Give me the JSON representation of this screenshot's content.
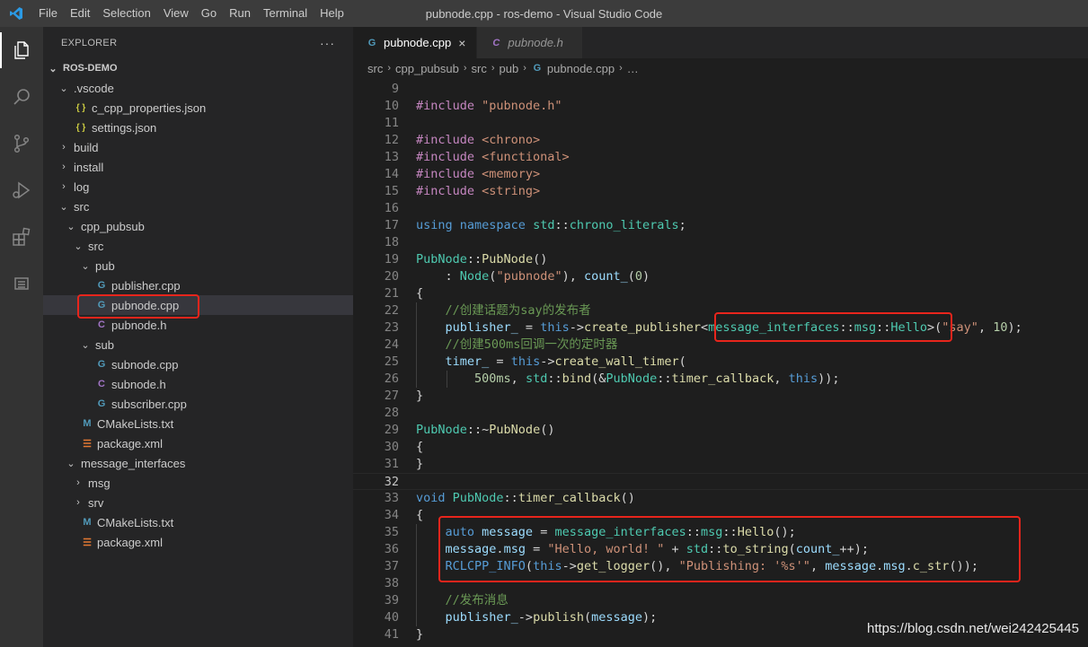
{
  "menu": [
    "File",
    "Edit",
    "Selection",
    "View",
    "Go",
    "Run",
    "Terminal",
    "Help"
  ],
  "window_title": "pubnode.cpp - ros-demo - Visual Studio Code",
  "activity_icons": [
    "files-icon",
    "search-icon",
    "source-control-icon",
    "run-debug-icon",
    "extensions-icon",
    "panel-icon"
  ],
  "sidebar": {
    "header": "EXPLORER",
    "more": "···",
    "root": "ROS-DEMO",
    "items": [
      {
        "label": ".vscode",
        "type": "folder-open",
        "depth": 1
      },
      {
        "label": "c_cpp_properties.json",
        "type": "json",
        "depth": 2
      },
      {
        "label": "settings.json",
        "type": "json",
        "depth": 2
      },
      {
        "label": "build",
        "type": "folder",
        "depth": 1
      },
      {
        "label": "install",
        "type": "folder",
        "depth": 1
      },
      {
        "label": "log",
        "type": "folder",
        "depth": 1
      },
      {
        "label": "src",
        "type": "folder-open",
        "depth": 1
      },
      {
        "label": "cpp_pubsub",
        "type": "folder-open",
        "depth": 2
      },
      {
        "label": "src",
        "type": "folder-open",
        "depth": 3
      },
      {
        "label": "pub",
        "type": "folder-open",
        "depth": 4
      },
      {
        "label": "publisher.cpp",
        "type": "cpp",
        "depth": 5
      },
      {
        "label": "pubnode.cpp",
        "type": "cpp",
        "depth": 5,
        "selected": true
      },
      {
        "label": "pubnode.h",
        "type": "h",
        "depth": 5
      },
      {
        "label": "sub",
        "type": "folder-open",
        "depth": 4
      },
      {
        "label": "subnode.cpp",
        "type": "cpp",
        "depth": 5
      },
      {
        "label": "subnode.h",
        "type": "h",
        "depth": 5
      },
      {
        "label": "subscriber.cpp",
        "type": "cpp",
        "depth": 5
      },
      {
        "label": "CMakeLists.txt",
        "type": "cmake",
        "depth": 3
      },
      {
        "label": "package.xml",
        "type": "xml",
        "depth": 3
      },
      {
        "label": "message_interfaces",
        "type": "folder-open",
        "depth": 2
      },
      {
        "label": "msg",
        "type": "folder",
        "depth": 3
      },
      {
        "label": "srv",
        "type": "folder",
        "depth": 3
      },
      {
        "label": "CMakeLists.txt",
        "type": "cmake",
        "depth": 3
      },
      {
        "label": "package.xml",
        "type": "xml",
        "depth": 3
      }
    ]
  },
  "tabs": [
    {
      "label": "pubnode.cpp",
      "active": true,
      "close": "×"
    },
    {
      "label": "pubnode.h",
      "active": false
    }
  ],
  "breadcrumb": [
    "src",
    "cpp_pubsub",
    "src",
    "pub",
    "pubnode.cpp",
    "…"
  ],
  "code_lines": [
    {
      "n": "9",
      "g": 0,
      "t": []
    },
    {
      "n": "10",
      "g": 0,
      "t": [
        [
          "pp",
          "#include "
        ],
        [
          "str",
          "\"pubnode.h\""
        ]
      ]
    },
    {
      "n": "11",
      "g": 0,
      "t": []
    },
    {
      "n": "12",
      "g": 0,
      "t": [
        [
          "pp",
          "#include "
        ],
        [
          "str",
          "<chrono>"
        ]
      ]
    },
    {
      "n": "13",
      "g": 0,
      "t": [
        [
          "pp",
          "#include "
        ],
        [
          "str",
          "<functional>"
        ]
      ]
    },
    {
      "n": "14",
      "g": 0,
      "t": [
        [
          "pp",
          "#include "
        ],
        [
          "str",
          "<memory>"
        ]
      ]
    },
    {
      "n": "15",
      "g": 0,
      "t": [
        [
          "pp",
          "#include "
        ],
        [
          "str",
          "<string>"
        ]
      ]
    },
    {
      "n": "16",
      "g": 0,
      "t": []
    },
    {
      "n": "17",
      "g": 0,
      "t": [
        [
          "kw",
          "using "
        ],
        [
          "kw",
          "namespace "
        ],
        [
          "cls",
          "std"
        ],
        [
          "pl",
          "::"
        ],
        [
          "cls",
          "chrono_literals"
        ],
        [
          "pl",
          ";"
        ]
      ]
    },
    {
      "n": "18",
      "g": 0,
      "t": []
    },
    {
      "n": "19",
      "g": 0,
      "t": [
        [
          "cls",
          "PubNode"
        ],
        [
          "pl",
          "::"
        ],
        [
          "fn",
          "PubNode"
        ],
        [
          "pl",
          "()"
        ]
      ]
    },
    {
      "n": "20",
      "g": 0,
      "t": [
        [
          "pl",
          "    : "
        ],
        [
          "cls",
          "Node"
        ],
        [
          "pl",
          "("
        ],
        [
          "str",
          "\"pubnode\""
        ],
        [
          "pl",
          "), "
        ],
        [
          "var",
          "count_"
        ],
        [
          "pl",
          "("
        ],
        [
          "num",
          "0"
        ],
        [
          "pl",
          ")"
        ]
      ]
    },
    {
      "n": "21",
      "g": 0,
      "t": [
        [
          "pl",
          "{"
        ]
      ]
    },
    {
      "n": "22",
      "g": 1,
      "t": [
        [
          "pl",
          "    "
        ],
        [
          "cm",
          "//创建话题为say的发布者"
        ]
      ]
    },
    {
      "n": "23",
      "g": 1,
      "t": [
        [
          "pl",
          "    "
        ],
        [
          "var",
          "publisher_"
        ],
        [
          "pl",
          " = "
        ],
        [
          "kw",
          "this"
        ],
        [
          "pl",
          "->"
        ],
        [
          "fn",
          "create_publisher"
        ],
        [
          "pl",
          "<"
        ],
        [
          "cls",
          "message_interfaces"
        ],
        [
          "pl",
          "::"
        ],
        [
          "cls",
          "msg"
        ],
        [
          "pl",
          "::"
        ],
        [
          "cls",
          "Hello"
        ],
        [
          "pl",
          ">("
        ],
        [
          "str",
          "\"say\""
        ],
        [
          "pl",
          ", "
        ],
        [
          "num",
          "10"
        ],
        [
          "pl",
          ");"
        ]
      ]
    },
    {
      "n": "24",
      "g": 1,
      "t": [
        [
          "pl",
          "    "
        ],
        [
          "cm",
          "//创建500ms回调一次的定时器"
        ]
      ]
    },
    {
      "n": "25",
      "g": 1,
      "t": [
        [
          "pl",
          "    "
        ],
        [
          "var",
          "timer_"
        ],
        [
          "pl",
          " = "
        ],
        [
          "kw",
          "this"
        ],
        [
          "pl",
          "->"
        ],
        [
          "fn",
          "create_wall_timer"
        ],
        [
          "pl",
          "("
        ]
      ]
    },
    {
      "n": "26",
      "g": 2,
      "t": [
        [
          "pl",
          "        "
        ],
        [
          "num",
          "500ms"
        ],
        [
          "pl",
          ", "
        ],
        [
          "cls",
          "std"
        ],
        [
          "pl",
          "::"
        ],
        [
          "fn",
          "bind"
        ],
        [
          "pl",
          "(&"
        ],
        [
          "cls",
          "PubNode"
        ],
        [
          "pl",
          "::"
        ],
        [
          "fn",
          "timer_callback"
        ],
        [
          "pl",
          ", "
        ],
        [
          "kw",
          "this"
        ],
        [
          "pl",
          "));"
        ]
      ]
    },
    {
      "n": "27",
      "g": 0,
      "t": [
        [
          "pl",
          "}"
        ]
      ]
    },
    {
      "n": "28",
      "g": 0,
      "t": []
    },
    {
      "n": "29",
      "g": 0,
      "t": [
        [
          "cls",
          "PubNode"
        ],
        [
          "pl",
          "::~"
        ],
        [
          "fn",
          "PubNode"
        ],
        [
          "pl",
          "()"
        ]
      ]
    },
    {
      "n": "30",
      "g": 0,
      "t": [
        [
          "pl",
          "{"
        ]
      ]
    },
    {
      "n": "31",
      "g": 0,
      "t": [
        [
          "pl",
          "}"
        ]
      ]
    },
    {
      "n": "32",
      "g": 0,
      "t": [],
      "current": true
    },
    {
      "n": "33",
      "g": 0,
      "t": [
        [
          "kw",
          "void "
        ],
        [
          "cls",
          "PubNode"
        ],
        [
          "pl",
          "::"
        ],
        [
          "fn",
          "timer_callback"
        ],
        [
          "pl",
          "()"
        ]
      ]
    },
    {
      "n": "34",
      "g": 0,
      "t": [
        [
          "pl",
          "{"
        ]
      ]
    },
    {
      "n": "35",
      "g": 1,
      "t": [
        [
          "pl",
          "    "
        ],
        [
          "kw",
          "auto "
        ],
        [
          "var",
          "message"
        ],
        [
          "pl",
          " = "
        ],
        [
          "cls",
          "message_interfaces"
        ],
        [
          "pl",
          "::"
        ],
        [
          "cls",
          "msg"
        ],
        [
          "pl",
          "::"
        ],
        [
          "fn",
          "Hello"
        ],
        [
          "pl",
          "();"
        ]
      ]
    },
    {
      "n": "36",
      "g": 1,
      "t": [
        [
          "pl",
          "    "
        ],
        [
          "var",
          "message"
        ],
        [
          "pl",
          "."
        ],
        [
          "var",
          "msg"
        ],
        [
          "pl",
          " = "
        ],
        [
          "str",
          "\"Hello, world! \""
        ],
        [
          "pl",
          " + "
        ],
        [
          "cls",
          "std"
        ],
        [
          "pl",
          "::"
        ],
        [
          "fn",
          "to_string"
        ],
        [
          "pl",
          "("
        ],
        [
          "var",
          "count_"
        ],
        [
          "pl",
          "++);"
        ]
      ]
    },
    {
      "n": "37",
      "g": 1,
      "t": [
        [
          "pl",
          "    "
        ],
        [
          "kw",
          "RCLCPP_INFO"
        ],
        [
          "pl",
          "("
        ],
        [
          "kw",
          "this"
        ],
        [
          "pl",
          "->"
        ],
        [
          "fn",
          "get_logger"
        ],
        [
          "pl",
          "(), "
        ],
        [
          "str",
          "\"Publishing: '%s'\""
        ],
        [
          "pl",
          ", "
        ],
        [
          "var",
          "message"
        ],
        [
          "pl",
          "."
        ],
        [
          "var",
          "msg"
        ],
        [
          "pl",
          "."
        ],
        [
          "fn",
          "c_str"
        ],
        [
          "pl",
          "());"
        ]
      ]
    },
    {
      "n": "38",
      "g": 1,
      "t": []
    },
    {
      "n": "39",
      "g": 1,
      "t": [
        [
          "pl",
          "    "
        ],
        [
          "cm",
          "//发布消息"
        ]
      ]
    },
    {
      "n": "40",
      "g": 1,
      "t": [
        [
          "pl",
          "    "
        ],
        [
          "var",
          "publisher_"
        ],
        [
          "pl",
          "->"
        ],
        [
          "fn",
          "publish"
        ],
        [
          "pl",
          "("
        ],
        [
          "var",
          "message"
        ],
        [
          "pl",
          ");"
        ]
      ]
    },
    {
      "n": "41",
      "g": 0,
      "t": [
        [
          "pl",
          "}"
        ]
      ]
    }
  ],
  "watermark": "https://blog.csdn.net/wei242425445",
  "colors": {
    "annotation": "#e8251c",
    "selection": "#37373d"
  }
}
